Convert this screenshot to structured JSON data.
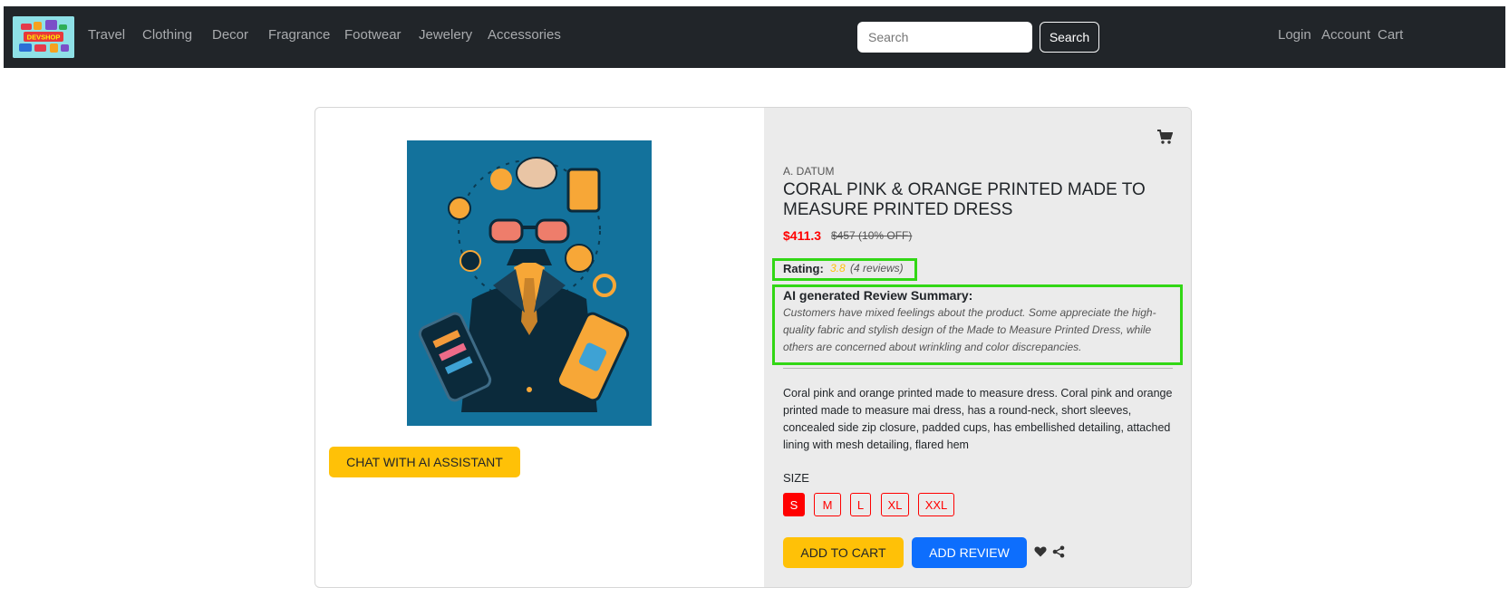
{
  "header": {
    "logo_text": "DEVSHOP",
    "nav_links": [
      "Travel",
      "Clothing",
      "Decor",
      "Fragrance",
      "Footwear",
      "Jewelery",
      "Accessories"
    ],
    "search_placeholder": "Search",
    "search_button": "Search",
    "right_links": [
      "Login",
      "Account",
      "Cart"
    ]
  },
  "product": {
    "brand": "A. DATUM",
    "title": "CORAL PINK & ORANGE PRINTED MADE TO MEASURE PRINTED DRESS",
    "price": "$411.3",
    "old_price": "$457 (10% OFF)",
    "rating_label": "Rating:",
    "rating_value": "3.8",
    "rating_count": "(4 reviews)",
    "summary_title": "AI generated Review Summary:",
    "summary_text": "Customers have mixed feelings about the product. Some appreciate the high-quality fabric and stylish design of the Made to Measure Printed Dress, while others are concerned about wrinkling and color discrepancies.",
    "description": "Coral pink and orange printed made to measure dress. Coral pink and orange printed made to measure mai dress, has a round-neck, short sleeves, concealed side zip closure, padded cups, has embellished detailing, attached lining with mesh detailing, flared hem",
    "size_label": "SIZE",
    "sizes": [
      "S",
      "M",
      "L",
      "XL",
      "XXL"
    ],
    "selected_size": "S",
    "add_to_cart": "ADD TO CART",
    "add_review": "ADD REVIEW",
    "chat_button": "CHAT WITH AI ASSISTANT"
  },
  "colors": {
    "navbar_bg": "#212529",
    "price_red": "#ff0000",
    "accent_yellow": "#ffc107",
    "primary_blue": "#0d6efd",
    "highlight_green": "#32d715"
  },
  "icons": [
    "cart-icon",
    "heart-icon",
    "share-icon"
  ]
}
